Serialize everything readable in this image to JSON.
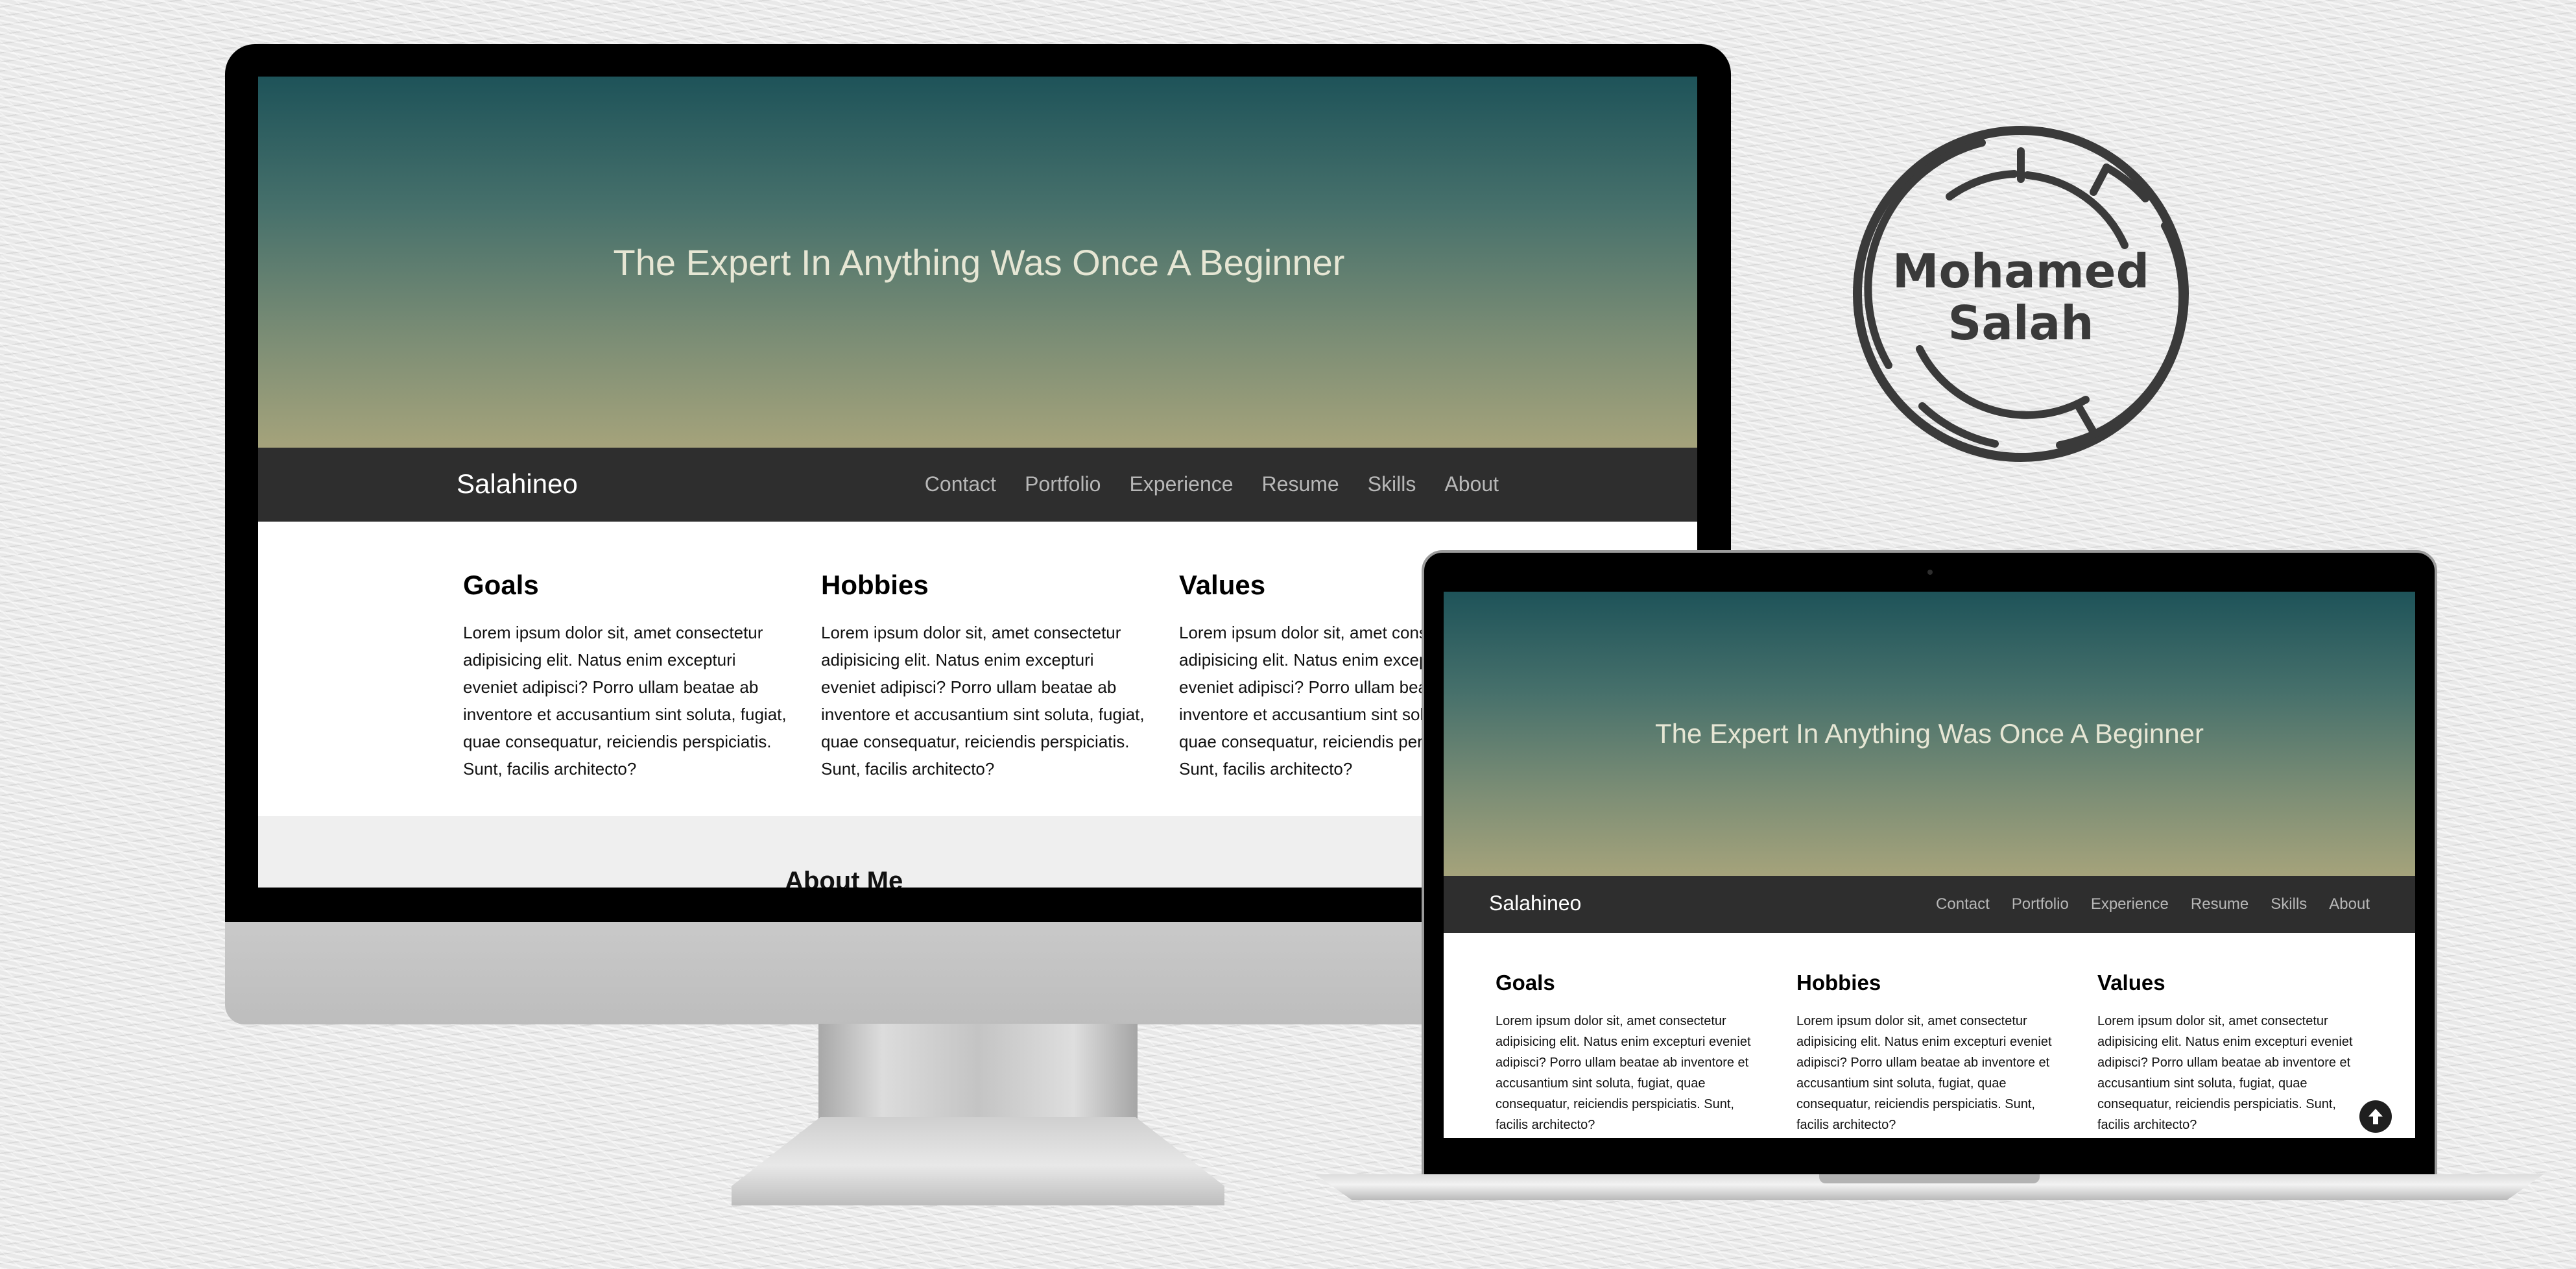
{
  "hero": {
    "title": "The Expert In Anything Was Once A Beginner"
  },
  "nav": {
    "brand": "Salahineo",
    "links": [
      "Contact",
      "Portfolio",
      "Experience",
      "Resume",
      "Skills",
      "About"
    ]
  },
  "sections": [
    {
      "title": "Goals",
      "text": "Lorem ipsum dolor sit, amet consectetur adipisicing elit. Natus enim excepturi eveniet adipisci? Porro ullam beatae ab inventore et accusantium sint soluta, fugiat, quae consequatur, reiciendis perspiciatis. Sunt, facilis architecto?"
    },
    {
      "title": "Hobbies",
      "text": "Lorem ipsum dolor sit, amet consectetur adipisicing elit. Natus enim excepturi eveniet adipisci? Porro ullam beatae ab inventore et accusantium sint soluta, fugiat, quae consequatur, reiciendis perspiciatis. Sunt, facilis architecto?"
    },
    {
      "title": "Values",
      "text": "Lorem ipsum dolor sit, amet consectetur adipisicing elit. Natus enim excepturi eveniet adipisci? Porro ullam beatae ab inventore et accusantium sint soluta, fugiat, quae consequatur, reiciendis perspiciatis. Sunt, facilis architecto?"
    }
  ],
  "about": {
    "title": "About Me"
  },
  "logo": {
    "line1": "Mohamed",
    "line2": "Salah"
  },
  "icons": {
    "scroll_top": "arrow-up-circle-icon"
  },
  "colors": {
    "hero_top": "#1e5359",
    "hero_bottom": "#a5a37b",
    "navbar": "#2e2e2e",
    "nav_link": "#b7b7b7",
    "logo": "#3a3a3a"
  }
}
